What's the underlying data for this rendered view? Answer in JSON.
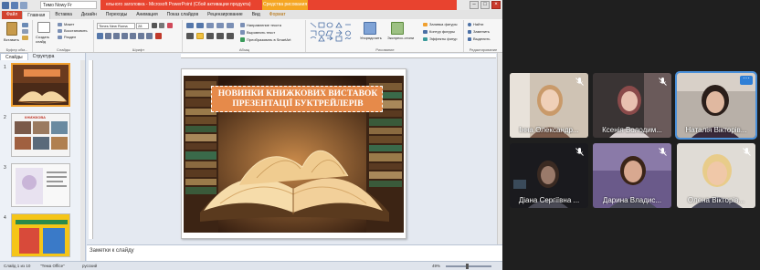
{
  "app": {
    "window_title": "ельного заголовка - Microsoft PowerPoint (Сбой активации продукта)",
    "share_tab": "Тимо Nowy Fr",
    "context_tab": "Средства рисования"
  },
  "ribbon": {
    "tabs": [
      "Файл",
      "Главная",
      "Вставка",
      "Дизайн",
      "Переходы",
      "Анимация",
      "Показ слайдов",
      "Рецензирование",
      "Вид",
      "Формат"
    ],
    "active_tab": "Главная",
    "groups": {
      "clipboard": {
        "label": "Буфер обм...",
        "paste": "Вставить"
      },
      "slides": {
        "label": "Слайды",
        "create": "Создать слайд",
        "layout": "Макет",
        "reset": "Восстановить",
        "section": "Раздел"
      },
      "font": {
        "label": "Шрифт",
        "font_name": "Times New Roma",
        "font_size": "28"
      },
      "paragraph": {
        "label": "Абзац",
        "direction": "Направление текста",
        "align": "Выровнять текст",
        "smartart": "Преобразовать в SmartArt"
      },
      "drawing": {
        "label": "Рисование",
        "arrange": "Упорядочить",
        "quick_styles": "Экспресс-стили",
        "fill": "Заливка фигуры",
        "outline": "Контур фигуры",
        "effects": "Эффекты фигур"
      },
      "editing": {
        "label": "Редактирование",
        "find": "Найти",
        "replace": "Заменить",
        "select": "Выделить"
      }
    }
  },
  "left_pane": {
    "tabs": [
      "Слайды",
      "Структура"
    ],
    "active_tab": "Слайды",
    "slides": [
      {
        "num": "1",
        "caption": ""
      },
      {
        "num": "2",
        "caption": "КНИЖКОВА"
      },
      {
        "num": "3",
        "caption": ""
      },
      {
        "num": "4",
        "caption": ""
      }
    ]
  },
  "slide": {
    "title_line1": "НОВИНКИ КНИЖКОВИХ ВИСТАВОК",
    "title_line2": "ПРЕЗЕНТАЦІЇ БУКТРЕЙЛЕРІВ"
  },
  "notes": {
    "placeholder": "Заметки к слайду"
  },
  "status": {
    "slide_counter": "Слайд 1 из 10",
    "theme": "\"Тема Office\"",
    "language": "русский",
    "zoom": "49%"
  },
  "participants": [
    {
      "name": "Інна Олександр...",
      "muted": true,
      "active": false
    },
    {
      "name": "Ксенія Володим...",
      "muted": true,
      "active": false
    },
    {
      "name": "Наталія Вікторів...",
      "muted": false,
      "active": true
    },
    {
      "name": "Діана Сергіївна ...",
      "muted": true,
      "active": false
    },
    {
      "name": "Дарина Владис...",
      "muted": true,
      "active": false
    },
    {
      "name": "Олена Вікторів...",
      "muted": true,
      "active": false
    }
  ],
  "colors": {
    "accent_blue": "#4a90d9",
    "ppt_red": "#d2432f",
    "title_orange": "#e68a4a"
  }
}
